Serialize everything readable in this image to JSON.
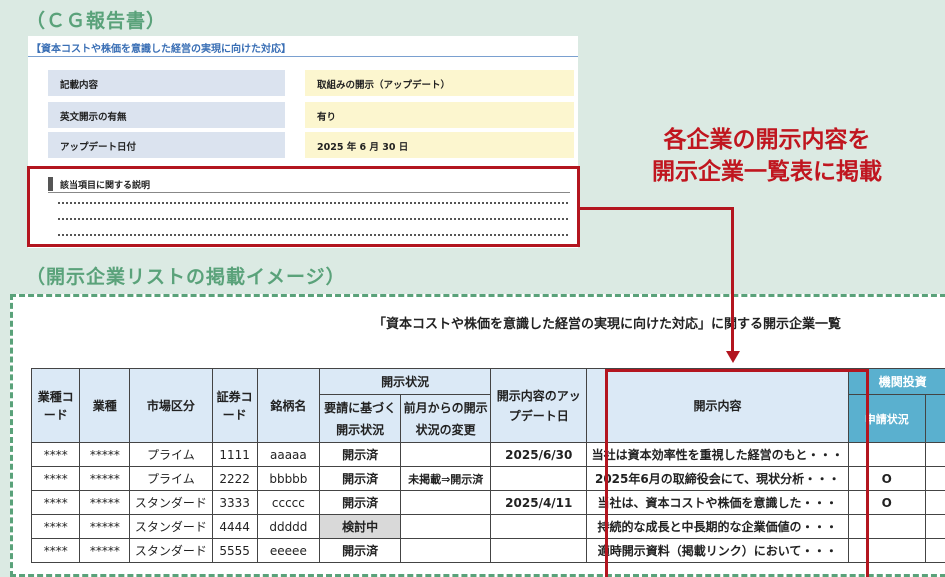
{
  "headings": {
    "cg_report": "（ＣＧ報告書）",
    "list_image": "（開示企業リストの掲載イメージ）"
  },
  "cg": {
    "title": "【資本コストや株価を意識した経営の実現に向けた対応】",
    "rows": [
      {
        "label": "記載内容",
        "value": "取組みの開示（アップデート）"
      },
      {
        "label": "英文開示の有無",
        "value": "有り"
      },
      {
        "label": "アップデート日付",
        "value": "2025 年 6 月 30 日"
      }
    ],
    "desc_label": "該当項目に関する説明"
  },
  "callout": {
    "line1": "各企業の開示内容を",
    "line2": "開示企業一覧表に掲載"
  },
  "list": {
    "title": "「資本コストや株価を意識した経営の実現に向けた対応」に関する開示企業一覧",
    "headers": {
      "industry_code": "業種コード",
      "industry": "業種",
      "market": "市場区分",
      "security_code": "証券コード",
      "name": "銘柄名",
      "status_group": "開示状況",
      "status_request": "要請に基づく開示状況",
      "status_change": "前月からの開示状況の変更",
      "update_date": "開示内容のアップデート日",
      "content": "開示内容",
      "investor_group": "機関投資",
      "apply_status": "申請状況"
    },
    "rows": [
      {
        "industry_code": "****",
        "industry": "*****",
        "market": "プライム",
        "code": "1111",
        "name": "aaaaa",
        "status": "開示済",
        "change": "",
        "date": "2025/6/30",
        "content": "当社は資本効率性を重視した経営のもと・・・",
        "apply": ""
      },
      {
        "industry_code": "****",
        "industry": "*****",
        "market": "プライム",
        "code": "2222",
        "name": "bbbbb",
        "status": "開示済",
        "change": "未掲載⇒開示済",
        "date": "",
        "content": "2025年6月の取締役会にて、現状分析・・・",
        "apply": "O"
      },
      {
        "industry_code": "****",
        "industry": "*****",
        "market": "スタンダード",
        "code": "3333",
        "name": "ccccc",
        "status": "開示済",
        "change": "",
        "date": "2025/4/11",
        "content": "当社は、資本コストや株価を意識した・・・",
        "apply": "O"
      },
      {
        "industry_code": "****",
        "industry": "*****",
        "market": "スタンダード",
        "code": "4444",
        "name": "ddddd",
        "status": "検討中",
        "change": "",
        "date": "",
        "content": "持続的な成長と中長期的な企業価値の・・・",
        "apply": ""
      },
      {
        "industry_code": "****",
        "industry": "*****",
        "market": "スタンダード",
        "code": "5555",
        "name": "eeeee",
        "status": "開示済",
        "change": "",
        "date": "",
        "content": "適時開示資料（掲載リンク）において・・・",
        "apply": ""
      }
    ]
  },
  "colors": {
    "accent_green": "#5aa27a",
    "highlight_red": "#b3151f",
    "header_blue": "#dbe9f6",
    "investor_header": "#5ab0cf"
  }
}
